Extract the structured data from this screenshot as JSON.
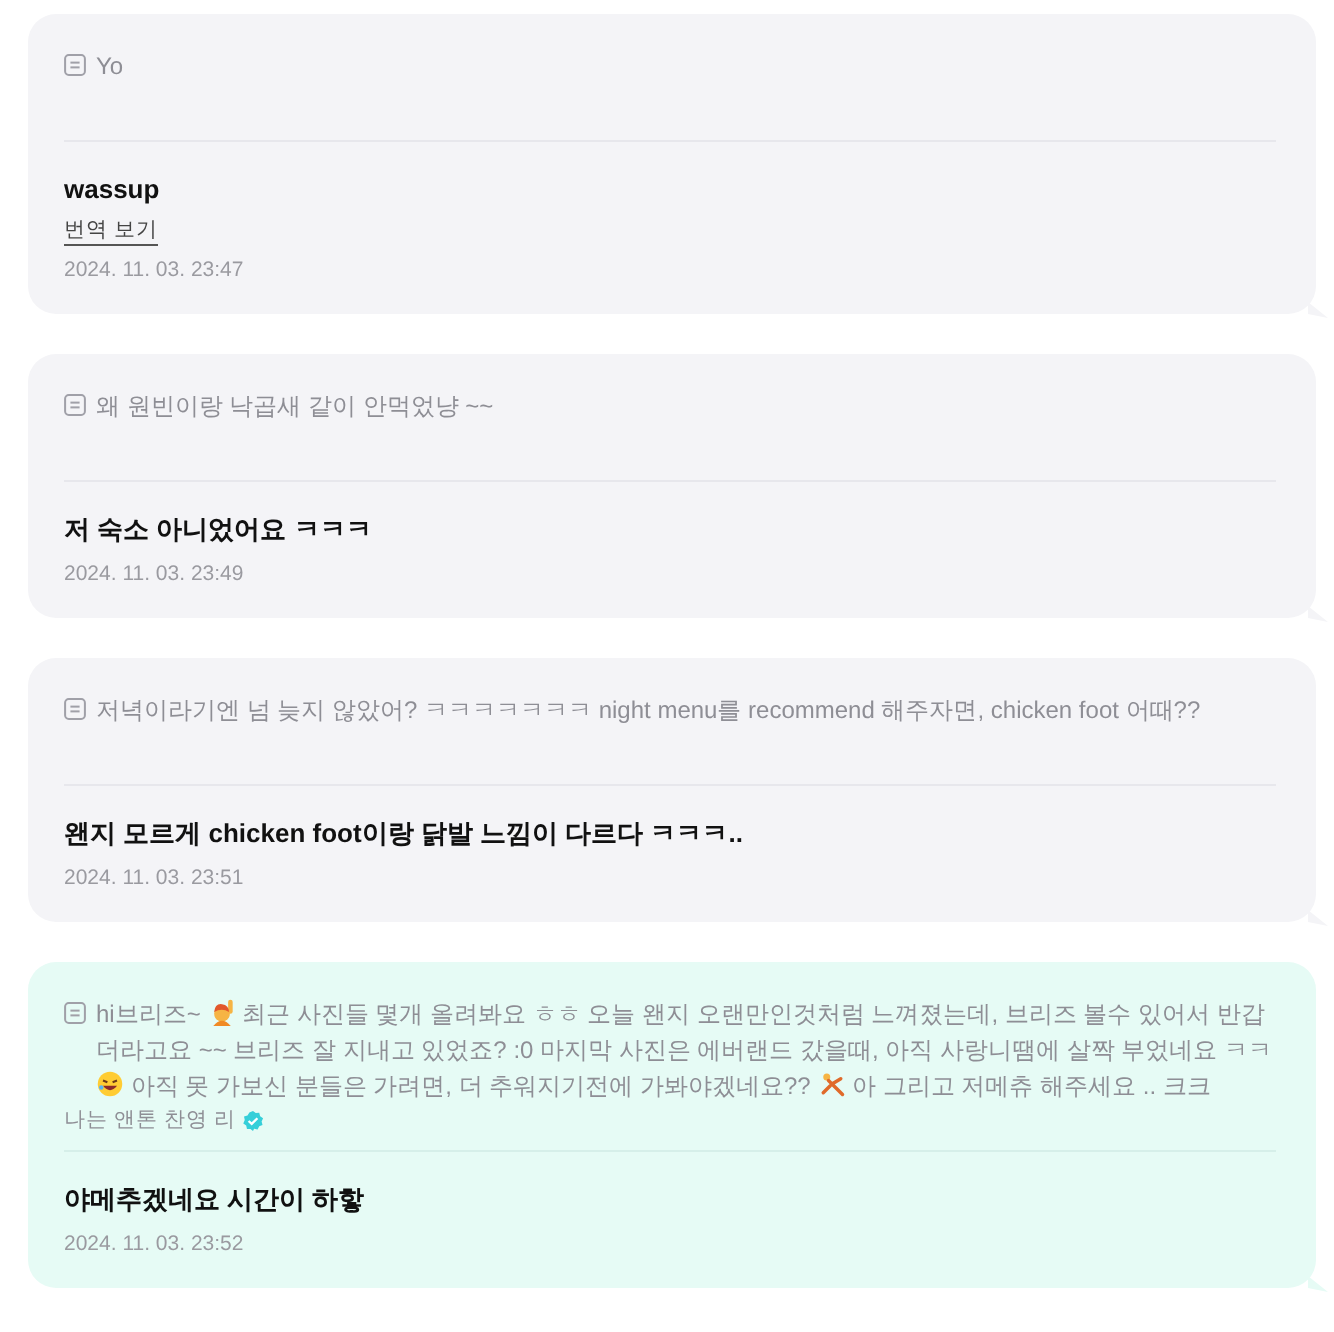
{
  "messages": [
    {
      "highlighted": false,
      "quote": [
        {
          "kind": "text",
          "text": "Yo"
        }
      ],
      "reply": "wassup",
      "translate_link": "번역 보기",
      "time": "2024. 11. 03. 23:47"
    },
    {
      "highlighted": false,
      "quote": [
        {
          "kind": "text",
          "text": "왜 원빈이랑 낙곱새 같이 안먹었냥 ~~"
        }
      ],
      "reply": "저 숙소 아니었어요 ㅋㅋㅋ",
      "time": "2024. 11. 03. 23:49"
    },
    {
      "highlighted": false,
      "quote": [
        {
          "kind": "text",
          "text": "저녁이라기엔 넘 늦지 않았어? ㅋㅋㅋㅋㅋㅋㅋ night menu를 recommend 해주자면, chicken foot 어때??"
        }
      ],
      "reply": "왠지 모르게 chicken foot이랑 닭발 느낌이 다르다 ㅋㅋㅋ..",
      "time": "2024. 11. 03. 23:51"
    },
    {
      "highlighted": true,
      "quote": [
        {
          "kind": "text",
          "text": "hi브리즈~ "
        },
        {
          "kind": "person"
        },
        {
          "kind": "text",
          "text": " 최근 사진들 몇개 올려봐요 ㅎㅎ 오늘 왠지 오랜만인것처럼 느껴졌는데, 브리즈 볼수 있어서 반갑더라고요 ~~ 브리즈 잘 지내고 있었죠? :0 마지막 사진은 에버랜드 갔을때, 아직 사랑니땜에 살짝 부었네요 ㅋㅋ "
        },
        {
          "kind": "laugh"
        },
        {
          "kind": "text",
          "text": " 아직 못 가보신 분들은 가려면, 더 추워지기전에 가봐야겠네요?? "
        },
        {
          "kind": "gymnast"
        },
        {
          "kind": "text",
          "text": " 아 그리고 저메츄 해주세요 .. 크크"
        }
      ],
      "author": "나는 앤톤 찬영 리",
      "verified": true,
      "reply": "야메추겠네요 시간이 하핳",
      "time": "2024. 11. 03. 23:52"
    }
  ]
}
